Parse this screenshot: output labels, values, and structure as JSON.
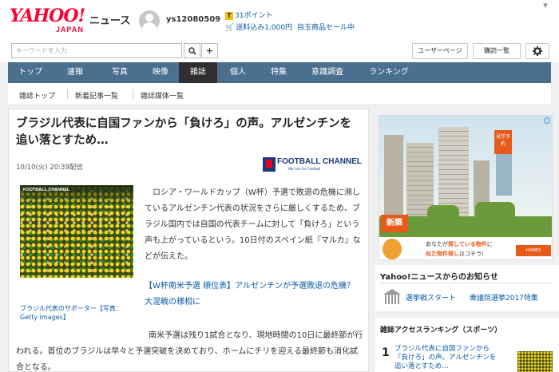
{
  "header": {
    "logo_text": "YAHOO!",
    "logo_sub": "JAPAN",
    "section_title": "ニュース",
    "username": "ys12080509",
    "points_text": "31ポイント",
    "shipping_text": "送料込み1,000円",
    "sale_text": "目玉商品セール中"
  },
  "search": {
    "placeholder": "キーワードを入力",
    "search_icon": "search-icon",
    "add_label": "+",
    "user_page_label": "ユーザーページ",
    "subscription_label": "購読一覧",
    "settings_icon": "gear-icon"
  },
  "nav": {
    "items": [
      "トップ",
      "速報",
      "写真",
      "映像",
      "雑誌",
      "個人",
      "特集",
      "意識調査",
      "ランキング"
    ],
    "active": "雑誌"
  },
  "subnav": {
    "items": [
      "雑誌トップ",
      "新着記事一覧",
      "雑誌媒体一覧"
    ]
  },
  "article": {
    "title": "ブラジル代表に自国ファンから「負けろ」の声。アルゼンチンを追い落とすため…",
    "date": "10/10(火) 20:39配信",
    "publisher_logo": "FOOTBALL CHANNEL",
    "publisher_tagline": "We Live For Football",
    "photo_logo": "FOOTBALL CHANNEL",
    "photo_caption": "ブラジル代表のサポーター【写真：Getty Images】",
    "paragraph1": "ロシア・ワールドカップ（W杯）予選で敗退の危機に瀕しているアルゼンチン代表の状況をさらに厳しくするため、ブラジル国内では自国の代表チームに対して「負けろ」という声も上がっているという。10日付のスペイン紙『マルカ』などが伝えた。",
    "related_link": "【W杯南米予選 順位表】アルゼンチンが予選敗退の危機？　大混戦の様相に",
    "paragraph2": "南米予選は残り1試合となり、現地時間の10日に最終節が行われる。首位のブラジルは早々と予選突破を決めており、ホームにチリを迎える最終節も消化試合となる。"
  },
  "ad": {
    "badge_new": "新築",
    "badge_corner": "見学予約",
    "line1_pre": "あなたが",
    "line1_em": "探している物件",
    "line1_post": "に",
    "line2_em": "似た物件探し",
    "line2_post": "はコチラ!",
    "brand": "HOMES",
    "info_icon": "info-icon"
  },
  "notice": {
    "title": "Yahoo!ニュースからのお知らせ",
    "links": [
      "選挙戦スタート",
      "衆議院選挙2017特集"
    ]
  },
  "ranking": {
    "title": "雑誌アクセスランキング（スポーツ）",
    "items": [
      {
        "rank": "1",
        "text": "ブラジル代表に自国ファンから「負けろ」の声。アルゼンチンを追い落とすため…"
      }
    ]
  }
}
